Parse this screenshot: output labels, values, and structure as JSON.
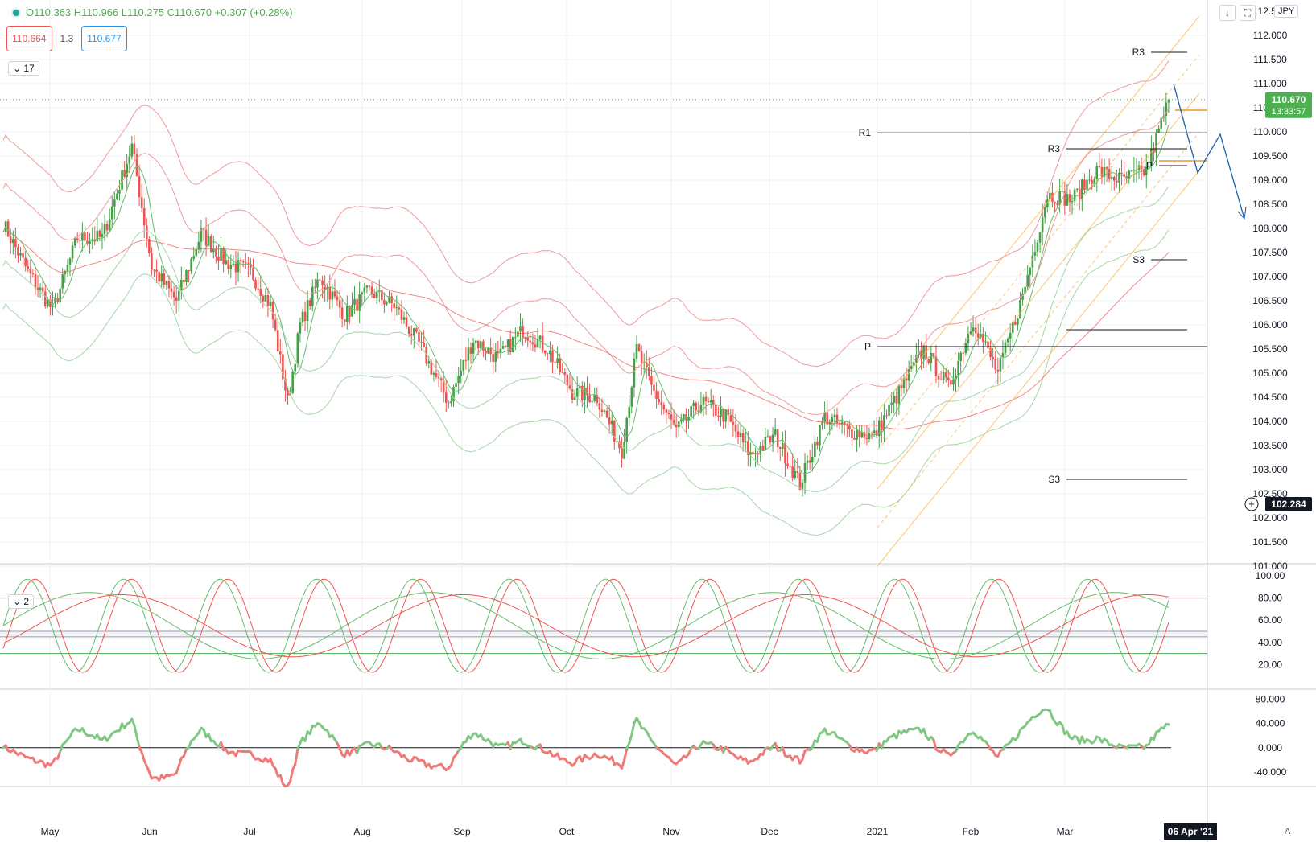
{
  "header": {
    "ohlc_text": "O110.363 H110.966 L110.275 C110.670 +0.307 (+0.28%)",
    "bid": "110.664",
    "spread": "1.3",
    "ask": "110.677",
    "collapse_main": "17",
    "collapse_osc": "2",
    "currency": "JPY",
    "download_icon": "↓",
    "fullscreen_icon": "⛶",
    "auto_label": "A"
  },
  "price_scale": {
    "ticks": [
      "112.000",
      "111.500",
      "111.000",
      "110.500",
      "110.000",
      "109.500",
      "109.000",
      "108.500",
      "108.000",
      "107.500",
      "107.000",
      "106.500",
      "106.000",
      "105.500",
      "105.000",
      "104.500",
      "104.000",
      "103.500",
      "103.000",
      "102.500",
      "102.000",
      "101.500",
      "101.000"
    ],
    "partial_top": "112.500"
  },
  "current_price": {
    "value": "110.670",
    "countdown": "13:33:57",
    "price": 110.67
  },
  "crosshair_label": {
    "value": "102.284",
    "price": 102.284
  },
  "stoch_scale": {
    "ticks": [
      "100.00",
      "80.00",
      "60.00",
      "40.00",
      "20.00"
    ]
  },
  "mom_scale": {
    "ticks": [
      "80.000",
      "40.000",
      "0.000",
      "-40.000"
    ]
  },
  "time_axis": {
    "labels": [
      "May",
      "Jun",
      "Jul",
      "Aug",
      "Sep",
      "Oct",
      "Nov",
      "Dec",
      "2021",
      "Feb",
      "Mar"
    ],
    "highlight": "06 Apr '21"
  },
  "colors": {
    "up": "#43a047",
    "down": "#ef5350",
    "bb_upper": "#ef9a9a",
    "bb_lower": "#a5d6a7",
    "ma_red": "#ef5350",
    "ma_green": "#66bb6a",
    "channel": "#ffb74d",
    "forecast": "#1e5fa8",
    "grid": "#eef0f3",
    "price_label": "#4caf50"
  },
  "chart_data": {
    "type": "candlestick",
    "ylim": [
      101,
      112.5
    ],
    "anchors": [
      [
        0,
        108.1
      ],
      [
        10,
        107.1
      ],
      [
        20,
        106.3
      ],
      [
        30,
        107.8
      ],
      [
        40,
        107.8
      ],
      [
        52,
        109.7
      ],
      [
        60,
        107.2
      ],
      [
        70,
        106.5
      ],
      [
        80,
        107.9
      ],
      [
        90,
        107.3
      ],
      [
        100,
        107.1
      ],
      [
        108,
        106.4
      ],
      [
        115,
        104.4
      ],
      [
        120,
        106.0
      ],
      [
        128,
        107.0
      ],
      [
        138,
        106.2
      ],
      [
        148,
        106.7
      ],
      [
        158,
        106.4
      ],
      [
        168,
        105.6
      ],
      [
        180,
        104.4
      ],
      [
        190,
        105.7
      ],
      [
        200,
        105.3
      ],
      [
        210,
        105.9
      ],
      [
        220,
        105.5
      ],
      [
        230,
        104.6
      ],
      [
        240,
        104.5
      ],
      [
        250,
        103.4
      ],
      [
        256,
        105.5
      ],
      [
        262,
        104.7
      ],
      [
        272,
        103.8
      ],
      [
        282,
        104.4
      ],
      [
        292,
        104.1
      ],
      [
        302,
        103.3
      ],
      [
        312,
        103.7
      ],
      [
        322,
        102.7
      ],
      [
        332,
        104.1
      ],
      [
        342,
        103.8
      ],
      [
        352,
        103.7
      ],
      [
        362,
        104.6
      ],
      [
        372,
        105.5
      ],
      [
        382,
        104.7
      ],
      [
        392,
        106.1
      ],
      [
        402,
        105.0
      ],
      [
        412,
        106.6
      ],
      [
        422,
        108.7
      ],
      [
        432,
        108.6
      ],
      [
        442,
        109.2
      ],
      [
        452,
        109.0
      ],
      [
        462,
        109.2
      ],
      [
        471,
        110.67
      ]
    ],
    "pivot_levels": [
      {
        "label": "R3",
        "value": 111.65
      },
      {
        "label": "R1",
        "value": 109.98
      },
      {
        "label": "R3",
        "value": 109.65
      },
      {
        "label": "P",
        "value": 109.3
      },
      {
        "label": "S3",
        "value": 107.35
      },
      {
        "label": "P",
        "value": 105.55
      },
      {
        "label": "S3",
        "value": 102.8
      }
    ],
    "stochastic": {
      "levels": [
        80,
        50,
        45,
        30
      ],
      "range": [
        0,
        100
      ]
    },
    "momentum": {
      "range": [
        -60,
        90
      ]
    }
  }
}
